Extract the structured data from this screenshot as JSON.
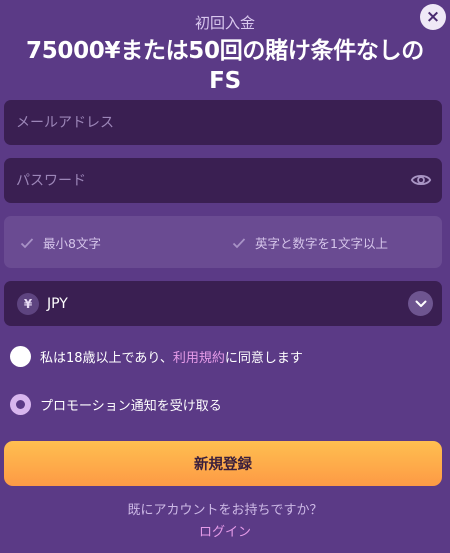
{
  "header": {
    "close_glyph": "×",
    "subtitle": "初回入金",
    "headline_line1": "75000¥または50回の賭け条件なしの",
    "headline_line2": "FS"
  },
  "form": {
    "email_placeholder": "メールアドレス",
    "password_placeholder": "パスワード",
    "password_rules": [
      {
        "label": "最小8文字",
        "met": true
      },
      {
        "label": "英字と数字を1文字以上",
        "met": true
      }
    ],
    "currency": {
      "symbol": "¥",
      "selected": "JPY"
    },
    "age_consent": {
      "text_before": "私は18歳以上であり、",
      "link_text": "利用規約",
      "text_after": "に同意します",
      "checked": false
    },
    "promotions": {
      "label": "プロモーション通知を受け取る",
      "checked": true
    },
    "submit_label": "新規登録"
  },
  "footer": {
    "have_account_text": "既にアカウントをお持ちですか？",
    "login_label": "ログイン"
  },
  "colors": {
    "background": "#5b3a86",
    "field": "#3a1f52",
    "accent_link": "#e59be8",
    "button_top": "#ffbf50",
    "button_bottom": "#fd9a45"
  },
  "icons": [
    "close-icon",
    "eye-icon",
    "check-icon",
    "yen-icon",
    "chevron-down-icon"
  ]
}
